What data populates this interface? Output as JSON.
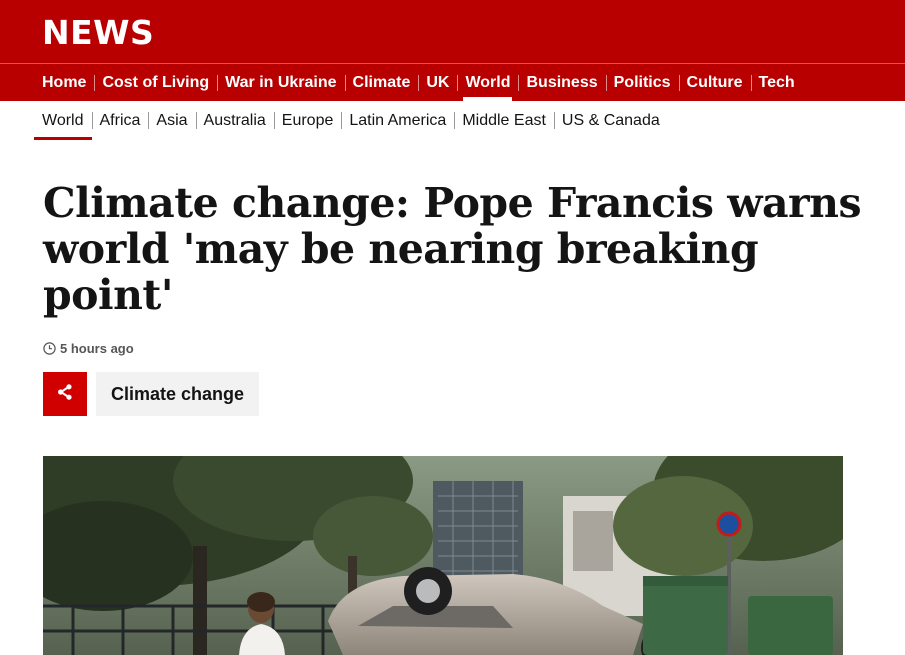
{
  "site": {
    "logo": "NEWS"
  },
  "topnav": {
    "items": [
      {
        "label": "Home",
        "active": false
      },
      {
        "label": "Cost of Living",
        "active": false
      },
      {
        "label": "War in Ukraine",
        "active": false
      },
      {
        "label": "Climate",
        "active": false
      },
      {
        "label": "UK",
        "active": false
      },
      {
        "label": "World",
        "active": true
      },
      {
        "label": "Business",
        "active": false
      },
      {
        "label": "Politics",
        "active": false
      },
      {
        "label": "Culture",
        "active": false
      },
      {
        "label": "Tech",
        "active": false
      }
    ]
  },
  "subnav": {
    "items": [
      {
        "label": "World",
        "active": true
      },
      {
        "label": "Africa",
        "active": false
      },
      {
        "label": "Asia",
        "active": false
      },
      {
        "label": "Australia",
        "active": false
      },
      {
        "label": "Europe",
        "active": false
      },
      {
        "label": "Latin America",
        "active": false
      },
      {
        "label": "Middle East",
        "active": false
      },
      {
        "label": "US & Canada",
        "active": false
      }
    ]
  },
  "article": {
    "headline": "Climate change: Pope Francis warns world 'may be nearing breaking point'",
    "timestamp": "5 hours ago",
    "share_icon": "share-icon",
    "topic_tag": "Climate change",
    "hero_image_subject": "overturned car on flooded street with trees and a woman walking"
  },
  "colors": {
    "brand_red": "#b80000",
    "share_red": "#d10000",
    "tag_bg": "#f2f2f2",
    "text": "#141414"
  }
}
